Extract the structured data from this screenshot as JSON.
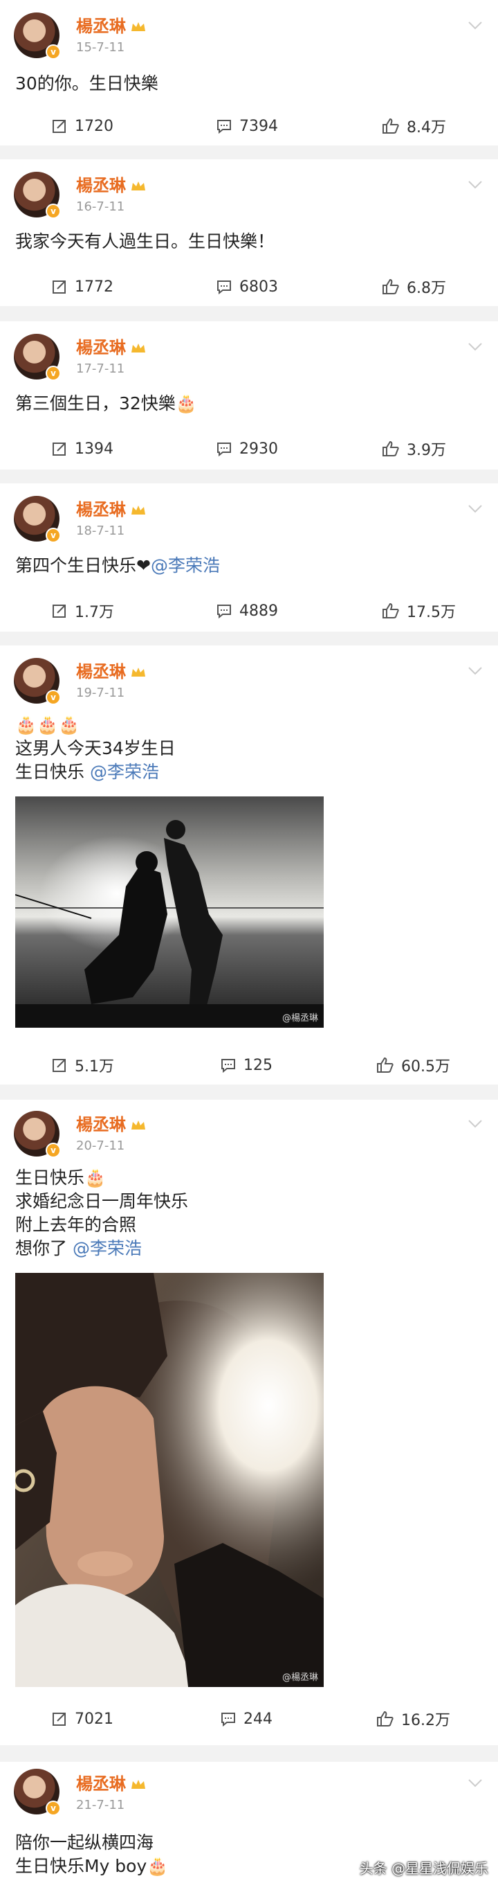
{
  "posts": [
    {
      "name": "楊丞琳",
      "date": "15-7-11",
      "text": [
        "30的你。生日快樂"
      ],
      "repost": "1720",
      "comment": "7394",
      "like": "8.4万"
    },
    {
      "name": "楊丞琳",
      "date": "16-7-11",
      "text": [
        "我家今天有人過生日。生日快樂！"
      ],
      "repost": "1772",
      "comment": "6803",
      "like": "6.8万"
    },
    {
      "name": "楊丞琳",
      "date": "17-7-11",
      "text": [
        "第三個生日，32快樂🎂"
      ],
      "repost": "1394",
      "comment": "2930",
      "like": "3.9万"
    },
    {
      "name": "楊丞琳",
      "date": "18-7-11",
      "text_prefix": "第四个生日快乐❤",
      "mention": "@李荣浩",
      "repost": "1.7万",
      "comment": "4889",
      "like": "17.5万"
    },
    {
      "name": "楊丞琳",
      "date": "19-7-11",
      "emoji_line": "🎂🎂🎂",
      "text": [
        "这男人今天34岁生日"
      ],
      "text_last_prefix": "生日快乐 ",
      "mention": "@李荣浩",
      "watermark": "@楊丞琳",
      "repost": "5.1万",
      "comment": "125",
      "like": "60.5万"
    },
    {
      "name": "楊丞琳",
      "date": "20-7-11",
      "text": [
        "生日快乐🎂",
        "求婚纪念日一周年快乐",
        "附上去年的合照"
      ],
      "text_last_prefix": "想你了 ",
      "mention": "@李荣浩",
      "watermark": "@楊丞琳",
      "repost": "7021",
      "comment": "244",
      "like": "16.2万"
    },
    {
      "name": "楊丞琳",
      "date": "21-7-11",
      "text": [
        "陪你一起纵横四海",
        "生日快乐My boy🎂"
      ]
    }
  ],
  "footer": "头条 @星星浅侃娱乐",
  "colors": {
    "name": "#e86c21",
    "mention": "#4a79b8",
    "meta": "#999999",
    "gap": "#f2f2f2"
  }
}
